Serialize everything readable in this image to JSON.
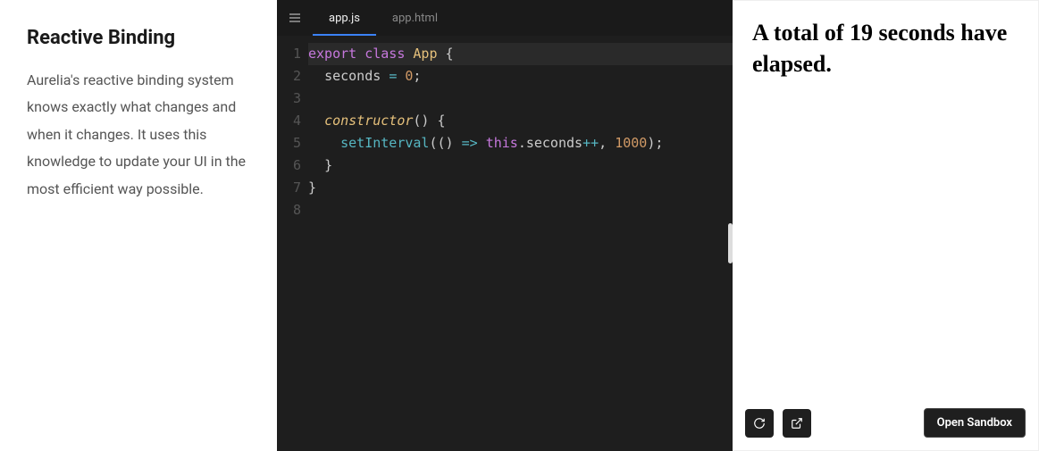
{
  "sidebar": {
    "title": "Reactive Binding",
    "description": "Aurelia's reactive binding system knows exactly what changes and when it changes. It uses this knowledge to update your UI in the most efficient way possible."
  },
  "editor": {
    "tabs": [
      {
        "label": "app.js",
        "active": true
      },
      {
        "label": "app.html",
        "active": false
      }
    ],
    "code": {
      "line_count": 8,
      "lines": [
        {
          "n": 1,
          "raw": "export class App {",
          "highlighted": true
        },
        {
          "n": 2,
          "raw": "  seconds = 0;"
        },
        {
          "n": 3,
          "raw": ""
        },
        {
          "n": 4,
          "raw": "  constructor() {"
        },
        {
          "n": 5,
          "raw": "    setInterval(() => this.seconds++, 1000);"
        },
        {
          "n": 6,
          "raw": "  }"
        },
        {
          "n": 7,
          "raw": "}"
        },
        {
          "n": 8,
          "raw": ""
        }
      ],
      "tokens": {
        "export": "export",
        "class": "class",
        "App": "App",
        "seconds": "seconds",
        "zero": "0",
        "constructor": "constructor",
        "setInterval": "setInterval",
        "this": "this",
        "interval_ms": "1000"
      }
    }
  },
  "preview": {
    "output_text": "A total of 19 seconds have elapsed.",
    "seconds_elapsed": 19,
    "open_sandbox_label": "Open Sandbox"
  }
}
